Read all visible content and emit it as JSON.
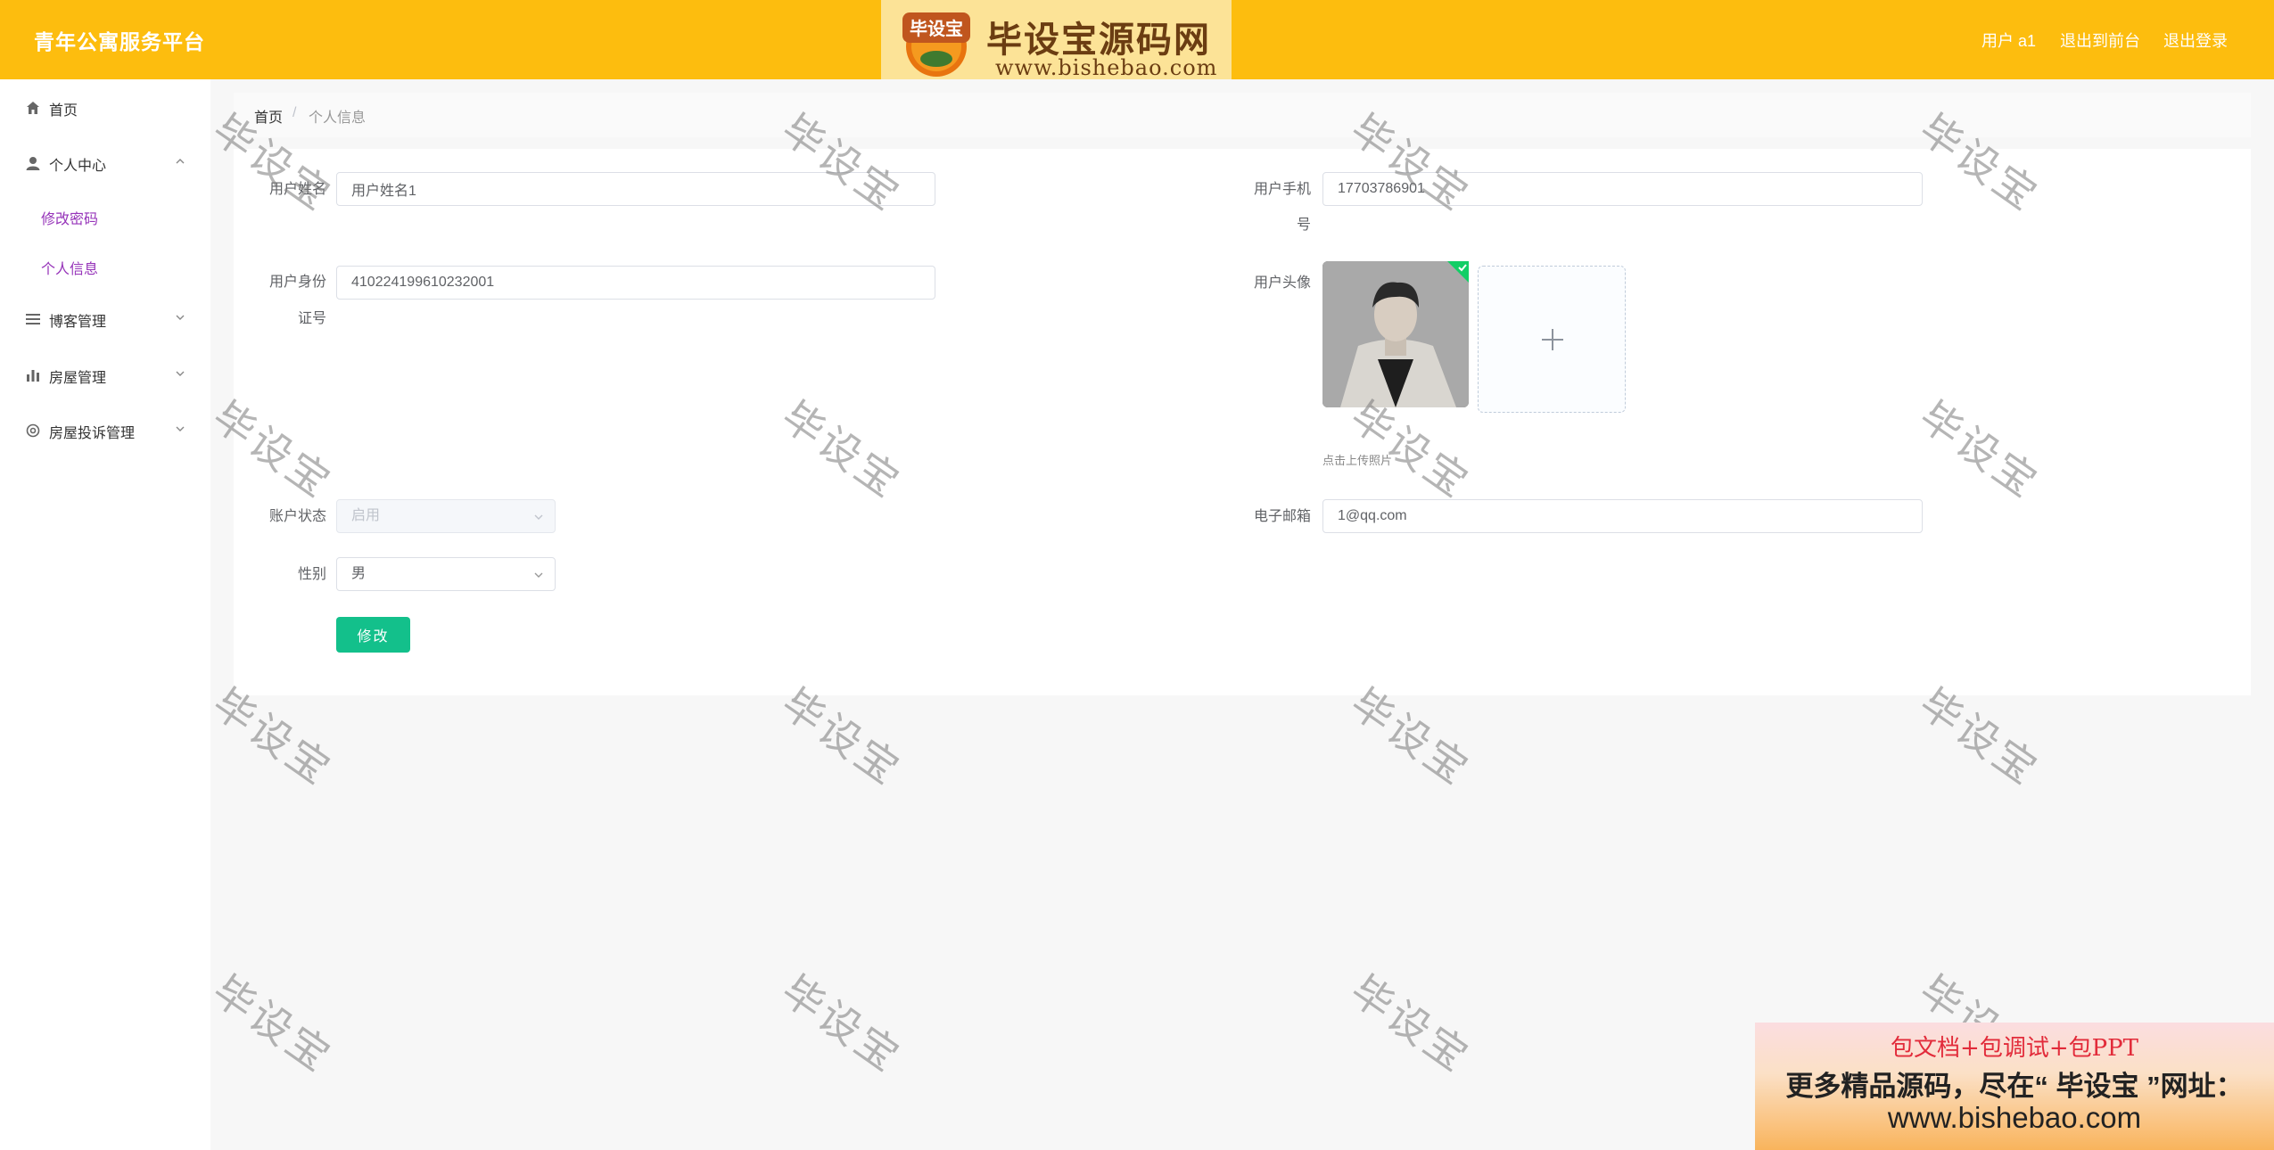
{
  "header": {
    "app_title": "青年公寓服务平台",
    "logo_badge": "毕设宝",
    "logo_text": "毕设宝源码网",
    "logo_url": "www.bishebao.com",
    "user_label": "用户 a1",
    "back_to_front": "退出到前台",
    "logout": "退出登录",
    "brand_color": "#fdbd0e"
  },
  "sidebar": {
    "items": [
      {
        "label": "首页",
        "icon": "home-icon"
      },
      {
        "label": "个人中心",
        "icon": "user-icon",
        "expanded": true
      },
      {
        "label": "博客管理",
        "icon": "list-icon"
      },
      {
        "label": "房屋管理",
        "icon": "bar-chart-icon"
      },
      {
        "label": "房屋投诉管理",
        "icon": "gear-icon"
      }
    ],
    "sub_items": [
      {
        "label": "修改密码"
      },
      {
        "label": "个人信息"
      }
    ],
    "sub_color": "#9633b9"
  },
  "breadcrumb": {
    "home": "首页",
    "separator": "/",
    "current": "个人信息"
  },
  "form": {
    "username_label": "用户姓名",
    "username_value": "用户姓名1",
    "phone_label_1": "用户手机",
    "phone_label_2": "号",
    "phone_value": "17703786901",
    "idcard_label_1": "用户身份",
    "idcard_label_2": "证号",
    "idcard_value": "410224199610232001",
    "avatar_label": "用户头像",
    "upload_tip": "点击上传照片",
    "status_label": "账户状态",
    "status_value": "启用",
    "email_label": "电子邮箱",
    "email_value": "1@qq.com",
    "gender_label": "性别",
    "gender_value": "男",
    "submit_label": "修改",
    "submit_color": "#13c08b"
  },
  "watermark_text": "毕设宝",
  "promo": {
    "line1": "包文档+包调试+包PPT",
    "line2": "更多精品源码，尽在“ 毕设宝 ”网址：",
    "line3": "www.bishebao.com"
  }
}
